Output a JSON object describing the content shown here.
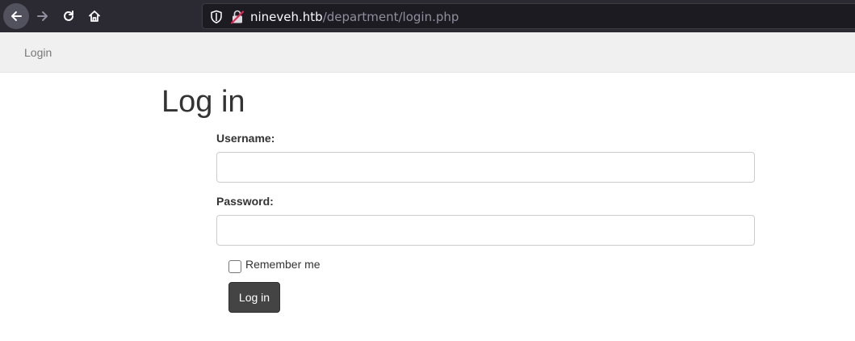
{
  "browser": {
    "url_host": "nineveh.htb",
    "url_path": "/department/login.php",
    "icons": [
      "back-arrow-icon",
      "forward-arrow-icon",
      "reload-icon",
      "home-icon",
      "shield-icon",
      "insecure-lock-icon"
    ]
  },
  "navbar": {
    "link_label": "Login"
  },
  "form": {
    "title": "Log in",
    "username_label": "Username:",
    "username_value": "",
    "password_label": "Password:",
    "password_value": "",
    "remember_label": "Remember me",
    "remember_checked": false,
    "submit_label": "Log in"
  },
  "colors": {
    "chrome_bg": "#2b2a33",
    "urlbar_bg": "#1c1b22",
    "navbar_bg": "#f0f0f0",
    "button_bg": "#444444"
  }
}
